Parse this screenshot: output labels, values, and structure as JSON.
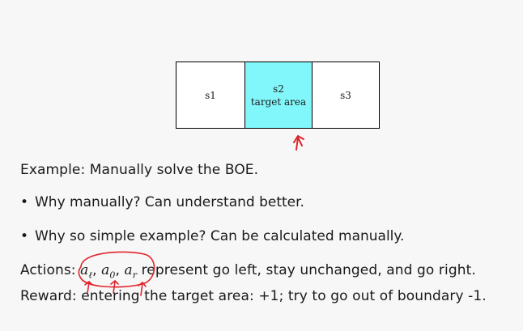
{
  "grid": {
    "cells": [
      {
        "label": "s1",
        "sub": ""
      },
      {
        "label": "s2",
        "sub": "target area"
      },
      {
        "label": "s3",
        "sub": ""
      }
    ],
    "highlight_color": "#82f7fb"
  },
  "text": {
    "example": "Example: Manually solve the BOE.",
    "bullet1": "Why manually? Can understand better.",
    "bullet2": "Why so simple example? Can be calculated manually.",
    "actions_prefix": "Actions: ",
    "a_left": "a",
    "a_left_sub": "ℓ",
    "a_stay": "a",
    "a_stay_sub": "0",
    "a_right": "a",
    "a_right_sub": "r",
    "actions_suffix": " represent go left, stay unchanged, and go right.",
    "reward": "Reward: entering the target area: +1; try to go out of boundary -1."
  },
  "annotation_color": "#e0242b"
}
